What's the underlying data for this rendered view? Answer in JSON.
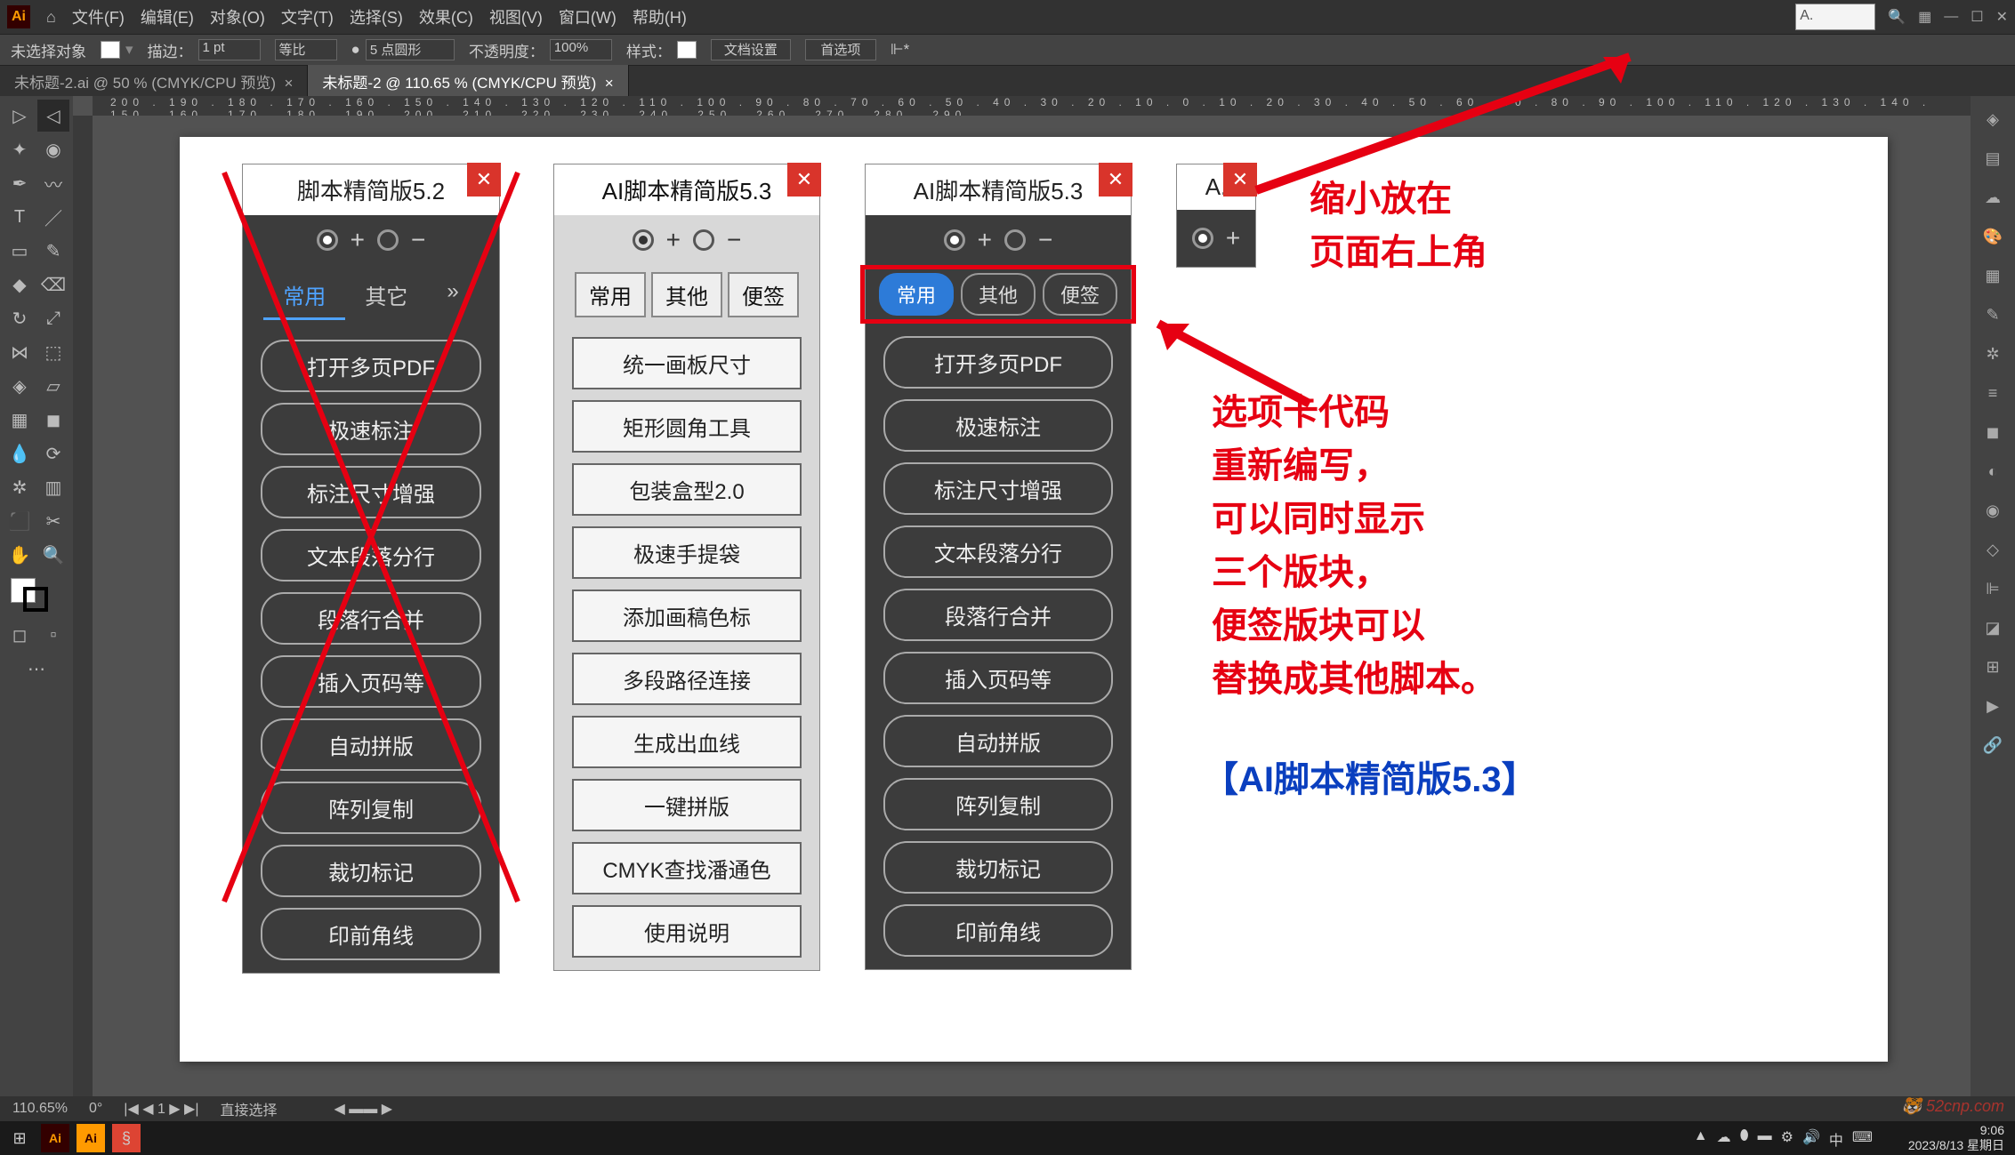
{
  "menu": {
    "items": [
      "文件(F)",
      "编辑(E)",
      "对象(O)",
      "文字(T)",
      "选择(S)",
      "效果(C)",
      "视图(V)",
      "窗口(W)",
      "帮助(H)"
    ]
  },
  "top_input": "A.",
  "optbar": {
    "nosel": "未选择对象",
    "stroke_lbl": "描边：",
    "stroke_val": "1 pt",
    "uniform": "等比",
    "pt5": "5 点圆形",
    "opacity_lbl": "不透明度：",
    "opacity_val": "100%",
    "style_lbl": "样式：",
    "docset": "文档设置",
    "prefs": "首选项"
  },
  "doc_tabs": {
    "t1": "未标题-2.ai @ 50 % (CMYK/CPU 预览)",
    "t2": "未标题-2 @ 110.65 % (CMYK/CPU 预览)"
  },
  "ruler": "200 . 190 . 180 . 170 . 160 . 150 . 140 . 130 . 120 . 110 . 100 . 90 . 80 . 70 . 60 . 50 . 40 . 30 . 20 . 10 . 0 . 10 . 20 . 30 . 40 . 50 . 60 . 70 . 80 . 90 . 100 . 110 . 120 . 130 . 140 . 150 . 160 . 170 . 180 . 190 . 200 . 210 . 220 . 230 . 240 . 250 . 260 . 270 . 280 . 290",
  "panel52": {
    "title": "脚本精简版5.2",
    "tabs": [
      "常用",
      "其它"
    ],
    "buttons": [
      "打开多页PDF",
      "极速标注",
      "标注尺寸增强",
      "文本段落分行",
      "段落行合并",
      "插入页码等",
      "自动拼版",
      "阵列复制",
      "裁切标记",
      "印前角线"
    ]
  },
  "panel53l": {
    "title": "AI脚本精简版5.3",
    "tabs": [
      "常用",
      "其他",
      "便签"
    ],
    "buttons": [
      "统一画板尺寸",
      "矩形圆角工具",
      "包装盒型2.0",
      "极速手提袋",
      "添加画稿色标",
      "多段路径连接",
      "生成出血线",
      "一键拼版",
      "CMYK查找潘通色",
      "使用说明"
    ]
  },
  "panel53d": {
    "title": "AI脚本精简版5.3",
    "tabs": [
      "常用",
      "其他",
      "便签"
    ],
    "buttons": [
      "打开多页PDF",
      "极速标注",
      "标注尺寸增强",
      "文本段落分行",
      "段落行合并",
      "插入页码等",
      "自动拼版",
      "阵列复制",
      "裁切标记",
      "印前角线"
    ]
  },
  "mini": {
    "title": "A."
  },
  "anno1_l1": "缩小放在",
  "anno1_l2": "页面右上角",
  "anno2_l1": "选项卡代码",
  "anno2_l2": "重新编写，",
  "anno2_l3": "可以同时显示",
  "anno2_l4": "三个版块，",
  "anno2_l5": "便签版块可以",
  "anno2_l6": "替换成其他脚本。",
  "anno_blue": "【AI脚本精简版5.3】",
  "status": {
    "zoom": "110.65%",
    "angle": "0°",
    "pg": "1",
    "tool": "直接选择"
  },
  "clock": {
    "time": "9:06",
    "date": "2023/8/13 星期日"
  },
  "watermark": "52cnp.com",
  "ime": "中"
}
